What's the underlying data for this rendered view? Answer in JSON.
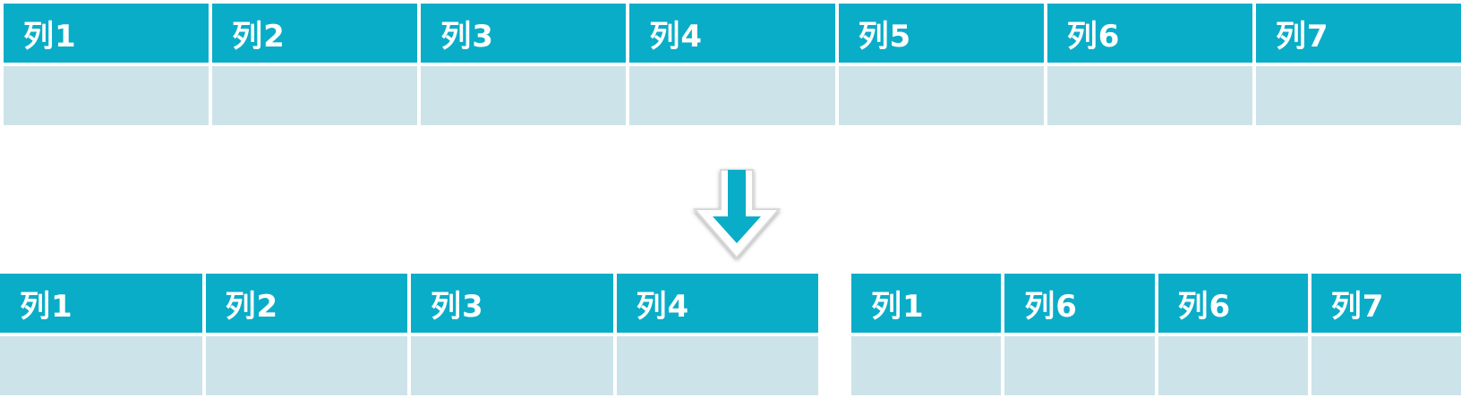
{
  "original_table": {
    "headers": [
      "列1",
      "列2",
      "列3",
      "列4",
      "列5",
      "列6",
      "列7"
    ]
  },
  "split_table_left": {
    "headers": [
      "列1",
      "列2",
      "列3",
      "列4"
    ]
  },
  "split_table_right": {
    "headers": [
      "列1",
      "列6",
      "列6",
      "列7"
    ]
  },
  "colors": {
    "header": "#0aadc8",
    "body": "#cde3ea",
    "arrow": "#0aadc8"
  },
  "icons": {
    "arrow": "down-arrow-icon"
  }
}
